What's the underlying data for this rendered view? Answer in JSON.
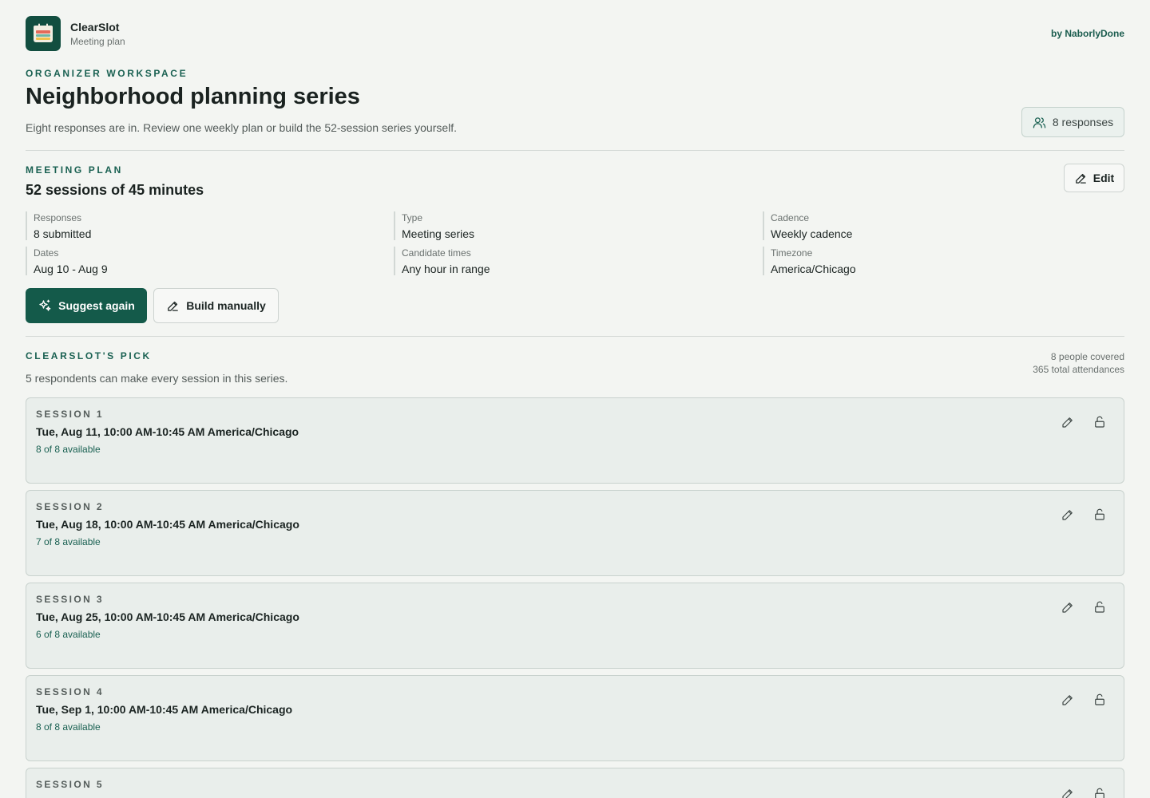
{
  "app": {
    "name": "ClearSlot",
    "subtitle": "Meeting plan",
    "byline": "by NaborlyDone",
    "logo_icon": "calendar-icon"
  },
  "workspace": {
    "eyebrow": "ORGANIZER WORKSPACE",
    "title": "Neighborhood planning series",
    "description": "Eight responses are in. Review one weekly plan or build the 52-session series yourself.",
    "responses_button": "8 responses",
    "responses_icon": "users-icon"
  },
  "plan": {
    "eyebrow": "MEETING PLAN",
    "title": "52 sessions of 45 minutes",
    "edit_label": "Edit",
    "facts": [
      {
        "label": "Responses",
        "value": "8 submitted"
      },
      {
        "label": "Type",
        "value": "Meeting series"
      },
      {
        "label": "Cadence",
        "value": "Weekly cadence"
      },
      {
        "label": "Dates",
        "value": "Aug 10 - Aug 9"
      },
      {
        "label": "Candidate times",
        "value": "Any hour in range"
      },
      {
        "label": "Timezone",
        "value": "America/Chicago"
      }
    ],
    "suggest_label": "Suggest again",
    "build_label": "Build manually"
  },
  "pick": {
    "eyebrow": "CLEARSLOT'S PICK",
    "description": "5 respondents can make every session in this series.",
    "people_covered": "8 people covered",
    "total_attendances": "365 total attendances",
    "sessions": [
      {
        "label": "SESSION 1",
        "time": "Tue, Aug 11, 10:00 AM-10:45 AM America/Chicago",
        "availability": "8 of 8 available"
      },
      {
        "label": "SESSION 2",
        "time": "Tue, Aug 18, 10:00 AM-10:45 AM America/Chicago",
        "availability": "7 of 8 available"
      },
      {
        "label": "SESSION 3",
        "time": "Tue, Aug 25, 10:00 AM-10:45 AM America/Chicago",
        "availability": "6 of 8 available"
      },
      {
        "label": "SESSION 4",
        "time": "Tue, Sep 1, 10:00 AM-10:45 AM America/Chicago",
        "availability": "8 of 8 available"
      },
      {
        "label": "SESSION 5",
        "time": "",
        "availability": ""
      }
    ]
  },
  "colors": {
    "accent": "#145a4a",
    "background": "#f3f5f2"
  }
}
